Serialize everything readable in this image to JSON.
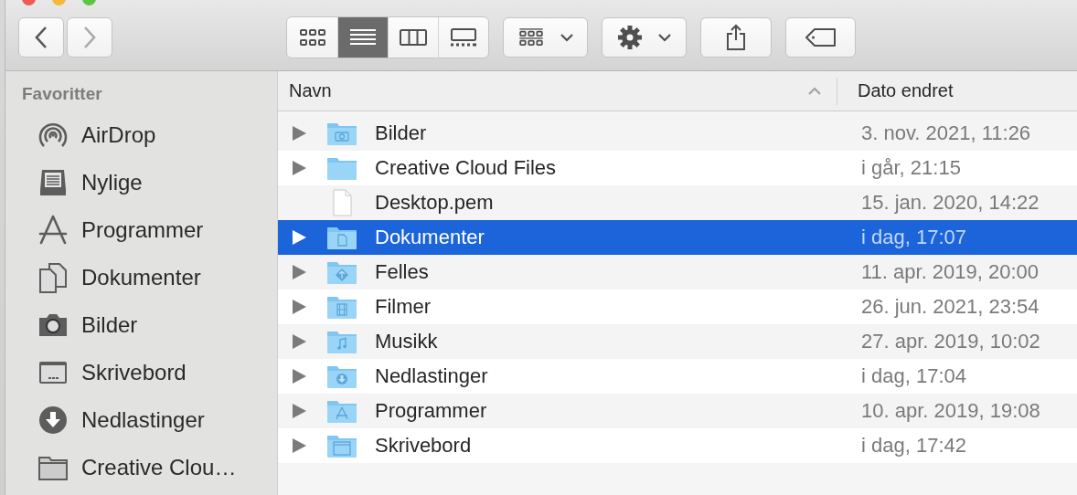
{
  "toolbar": {
    "navigation": [
      {
        "kind": "back",
        "disabled": false
      },
      {
        "kind": "forward",
        "disabled": true
      }
    ],
    "view_modes": [
      {
        "kind": "icons",
        "selected": false
      },
      {
        "kind": "list",
        "selected": true
      },
      {
        "kind": "columns",
        "selected": false
      },
      {
        "kind": "gallery",
        "selected": false
      }
    ],
    "actions": [
      {
        "kind": "group"
      },
      {
        "kind": "action"
      },
      {
        "kind": "share"
      },
      {
        "kind": "tags"
      }
    ]
  },
  "sidebar": {
    "heading": "Favoritter",
    "items": [
      {
        "label": "AirDrop",
        "kind": "airdrop",
        "selected": false
      },
      {
        "label": "Nylige",
        "kind": "recent",
        "selected": false
      },
      {
        "label": "Programmer",
        "kind": "apps",
        "selected": false
      },
      {
        "label": "Dokumenter",
        "kind": "documents",
        "selected": false
      },
      {
        "label": "Bilder",
        "kind": "photos",
        "selected": false
      },
      {
        "label": "Skrivebord",
        "kind": "desktop",
        "selected": false
      },
      {
        "label": "Nedlastinger",
        "kind": "downloads",
        "selected": false
      },
      {
        "label": "Creative Clou…",
        "kind": "folder",
        "selected": false
      }
    ]
  },
  "table": {
    "columns": [
      {
        "label": "Navn",
        "sorted": true
      },
      {
        "label": "Dato endret"
      }
    ],
    "rows": [
      {
        "name": "Bilder",
        "kind": "photos",
        "date": "3. nov. 2021, 11:26",
        "selected": false
      },
      {
        "name": "Creative Cloud Files",
        "kind": "folder",
        "date": "i går, 21:15",
        "selected": false
      },
      {
        "name": "Desktop.pem",
        "kind": "file",
        "date": "15. jan. 2020, 14:22",
        "selected": false
      },
      {
        "name": "Dokumenter",
        "kind": "documents",
        "date": "i dag, 17:07",
        "selected": true
      },
      {
        "name": "Felles",
        "kind": "shared",
        "date": "11. apr. 2019, 20:00",
        "selected": false
      },
      {
        "name": "Filmer",
        "kind": "movies",
        "date": "26. jun. 2021, 23:54",
        "selected": false
      },
      {
        "name": "Musikk",
        "kind": "music",
        "date": "27. apr. 2019, 10:02",
        "selected": false
      },
      {
        "name": "Nedlastinger",
        "kind": "downloads",
        "date": "i dag, 17:04",
        "selected": false
      },
      {
        "name": "Programmer",
        "kind": "apps",
        "date": "10. apr. 2019, 19:08",
        "selected": false
      },
      {
        "name": "Skrivebord",
        "kind": "desktop",
        "date": "i dag, 17:42",
        "selected": false
      }
    ]
  }
}
